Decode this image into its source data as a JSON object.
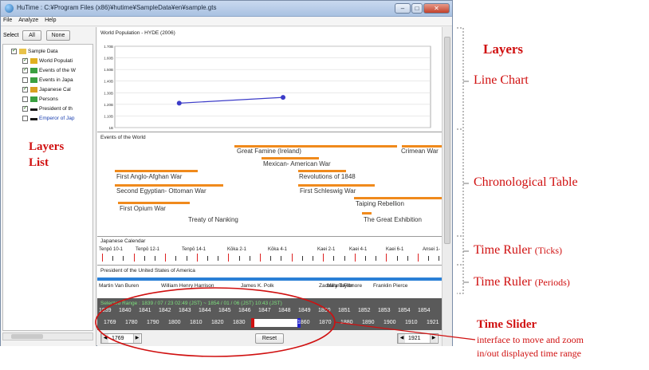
{
  "window": {
    "title": "HuTime : C:¥Program Files (x86)¥hutime¥SampleData¥en¥sample.gts",
    "btn_min": "–",
    "btn_max": "□",
    "btn_close": "✕"
  },
  "menu": [
    "File",
    "Analyze",
    "Help"
  ],
  "layers_panel": {
    "select_label": "Select",
    "all_button": "All",
    "none_button": "None",
    "items": [
      {
        "label": "Sample Data",
        "checked": true,
        "icon": "folder-icon",
        "indent": 0,
        "color": "#111111"
      },
      {
        "label": "World Populati",
        "checked": true,
        "icon": "line-chart-icon",
        "indent": 1,
        "color": "#111111"
      },
      {
        "label": "Events of the W",
        "checked": true,
        "icon": "chrono-icon",
        "indent": 1,
        "color": "#111111"
      },
      {
        "label": "Events in Japa",
        "checked": false,
        "icon": "chrono-icon",
        "indent": 1,
        "color": "#111111"
      },
      {
        "label": "Japanese Cal",
        "checked": true,
        "icon": "calendar-icon",
        "indent": 1,
        "color": "#111111"
      },
      {
        "label": "Persons",
        "checked": false,
        "icon": "chrono-icon",
        "indent": 1,
        "color": "#111111"
      },
      {
        "label": "President of th",
        "checked": true,
        "icon": "period-icon",
        "indent": 1,
        "color": "#111111"
      },
      {
        "label": "Emperor of Jap",
        "checked": false,
        "icon": "period-icon",
        "indent": 1,
        "color": "#1a3fb0"
      }
    ]
  },
  "line_chart": {
    "title": "World Population - HYDE (2006)",
    "y_ticks": [
      "1.70B",
      "1.60B",
      "1.50B",
      "1.40B",
      "1.30B",
      "1.20B",
      "1.10B",
      "1B"
    ],
    "line_color": "#3c3cc8"
  },
  "chart_data": {
    "type": "line",
    "title": "World Population - HYDE (2006)",
    "xlabel": "",
    "ylabel": "",
    "x": [
      1800,
      1850
    ],
    "series": [
      {
        "values": [
          1.21,
          1.26
        ]
      }
    ],
    "ylim": [
      1.0,
      1.7
    ]
  },
  "chrono_table": {
    "title": "Events of the World",
    "events": [
      {
        "label": "Great Famine (Ireland)"
      },
      {
        "label": "Crimean War"
      },
      {
        "label": "Mexican- American War"
      },
      {
        "label": "First Anglo-Afghan War"
      },
      {
        "label": "Revolutions of 1848"
      },
      {
        "label": "Second Egyptian- Ottoman War"
      },
      {
        "label": "First Schleswig War"
      },
      {
        "label": "Taiping Rebellion"
      },
      {
        "label": "First Opium War"
      },
      {
        "label": "Treaty of Nanking"
      },
      {
        "label": "The Great Exhibition"
      }
    ]
  },
  "japanese_calendar": {
    "title": "Japanese Calendar",
    "labels": [
      "Tenpō 10-1",
      "Tenpō 12-1",
      "Tenpō 14-1",
      "Kōka 2-1",
      "Kōka 4-1",
      "Kaei 2-1",
      "Kaei 4-1",
      "Kaei 6-1",
      "Ansei 1-"
    ]
  },
  "presidents": {
    "title": "President of the United States of America",
    "names": [
      "Martin Van Buren",
      "William Henry Harrison",
      "James K. Polk",
      "Zachary Taylor",
      "Millard Fillmore",
      "Franklin Pierce"
    ],
    "bar_color": "#2a7fd6"
  },
  "time_slider": {
    "range_text": "Selected Range : 1839 / 07 / 23 02:49 (JST) ~ 1854 / 01 / 06 (JST) 10:43 (JST)",
    "years_top": [
      "1839",
      "1840",
      "1841",
      "1842",
      "1843",
      "1844",
      "1845",
      "1846",
      "1847",
      "1848",
      "1849",
      "1850",
      "1851",
      "1852",
      "1853",
      "1854",
      "1854"
    ],
    "years_bottom": [
      "1769",
      "1780",
      "1790",
      "1800",
      "1810",
      "1820",
      "1830",
      "1840",
      "1850",
      "1860",
      "1870",
      "1880",
      "1890",
      "1900",
      "1910",
      "1921"
    ],
    "start_value": "1769",
    "end_value": "1921",
    "reset_label": "Reset",
    "spin_left": "◀",
    "spin_right": "▶"
  },
  "annotations": {
    "layers": "Layers",
    "line_chart": "Line Chart",
    "layers_list": "Layers\nList",
    "chrono": "Chronological Table",
    "ruler_ticks_main": "Time Ruler",
    "ruler_ticks_sub": "(Ticks)",
    "ruler_periods_main": "Time Ruler",
    "ruler_periods_sub": "(Periods)",
    "slider_title": "Time Slider",
    "slider_desc1": "interface to move and zoom",
    "slider_desc2": "in/out displayed time range",
    "annot_red": "#d01010"
  }
}
